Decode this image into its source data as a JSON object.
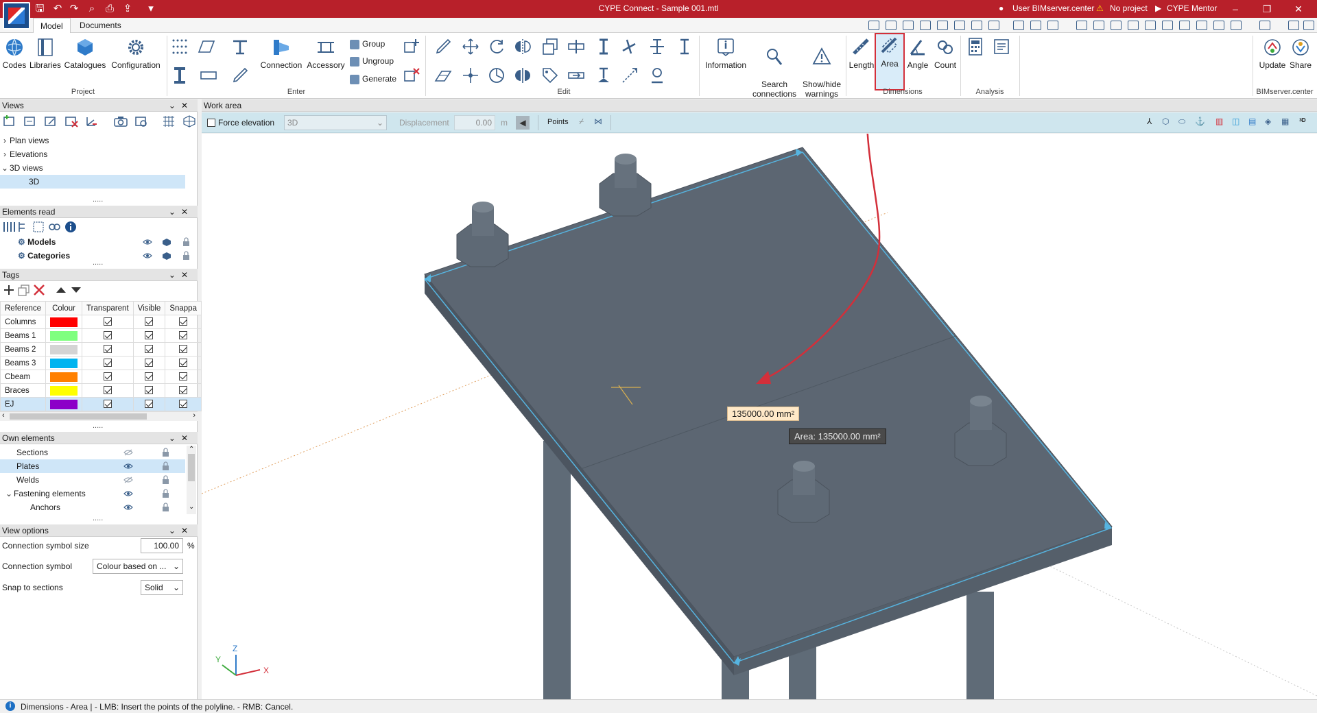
{
  "titlebar": {
    "title": "CYPE Connect - Sample 001.mtl",
    "user": "User BIMserver.center",
    "project": "No project",
    "mentor": "CYPE Mentor",
    "minimize": "–",
    "restore": "❐",
    "close": "✕"
  },
  "tabs": [
    "Model",
    "Documents"
  ],
  "ribbon": {
    "project": {
      "label": "Project",
      "buttons": [
        "Codes",
        "Libraries",
        "Catalogues",
        "Configuration"
      ]
    },
    "enter": {
      "label": "Enter",
      "connection": "Connection",
      "accessory": "Accessory",
      "group": "Group",
      "ungroup": "Ungroup",
      "generate": "Generate"
    },
    "edit": {
      "label": "Edit"
    },
    "info": {
      "information": "Information",
      "search": "Search\nconnections",
      "warnings": "Show/hide\nwarnings"
    },
    "dimensions": {
      "label": "Dimensions",
      "length": "Length",
      "area": "Area",
      "angle": "Angle",
      "count": "Count"
    },
    "analysis": {
      "label": "Analysis"
    },
    "bimserver": {
      "label": "BIMserver.center",
      "update": "Update",
      "share": "Share"
    }
  },
  "views_panel": {
    "title": "Views",
    "items": [
      {
        "label": "Plan views",
        "level": 0
      },
      {
        "label": "Elevations",
        "level": 0
      },
      {
        "label": "3D views",
        "level": 0
      },
      {
        "label": "3D",
        "level": 1
      }
    ],
    "more": "....."
  },
  "elements_read": {
    "title": "Elements read",
    "items": [
      "Models",
      "Categories"
    ],
    "more": "....."
  },
  "tags": {
    "title": "Tags",
    "columns": [
      "Reference",
      "Colour",
      "Transparent",
      "Visible",
      "Snappa"
    ],
    "rows": [
      {
        "ref": "Columns",
        "color": "#ff0000"
      },
      {
        "ref": "Beams 1",
        "color": "#7fff7f"
      },
      {
        "ref": "Beams 2",
        "color": "#d4d4d4"
      },
      {
        "ref": "Beams 3",
        "color": "#00b4f0"
      },
      {
        "ref": "Cbeam",
        "color": "#ff8000"
      },
      {
        "ref": "Braces",
        "color": "#ffff00"
      },
      {
        "ref": "EJ",
        "color": "#8c00c8"
      }
    ],
    "more": "....."
  },
  "own_elements": {
    "title": "Own elements",
    "items": [
      {
        "label": "Sections",
        "level": 1
      },
      {
        "label": "Plates",
        "level": 1
      },
      {
        "label": "Welds",
        "level": 1
      },
      {
        "label": "Fastening elements",
        "level": 0
      },
      {
        "label": "Anchors",
        "level": 2
      }
    ],
    "more": "....."
  },
  "view_options": {
    "title": "View options",
    "symbol_size_label": "Connection symbol size",
    "symbol_size_value": "100.00",
    "symbol_size_unit": "%",
    "symbol_label": "Connection symbol",
    "symbol_value": "Colour based on ...",
    "snap_label": "Snap to sections",
    "snap_value": "Solid"
  },
  "work_area": {
    "title": "Work area",
    "force_elevation": "Force elevation",
    "view_select": "3D",
    "displacement_label": "Displacement",
    "displacement_value": "0.00",
    "displacement_unit": "m",
    "points_label": "Points"
  },
  "viewport": {
    "area_label": "135000.00 mm²",
    "area_tooltip": "Area: 135000.00 mm²",
    "axis_x": "X",
    "axis_y": "Y",
    "axis_z": "Z"
  },
  "statusbar": {
    "text": "Dimensions - Area  |  - LMB: Insert the points of the polyline. - RMB: Cancel."
  },
  "colors": {
    "title_red": "#b8202a",
    "plate": "#5c6672",
    "plate_edge": "#4a525c",
    "measure_line": "#56b4e0",
    "arrow": "#d32f3a",
    "label_bg": "#ffe9c8"
  }
}
